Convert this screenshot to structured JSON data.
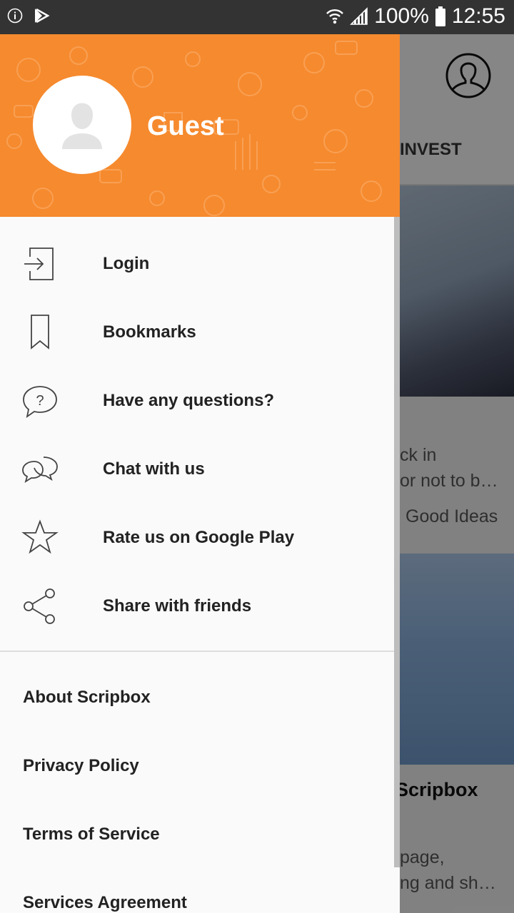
{
  "status_bar": {
    "battery": "100%",
    "time": "12:55",
    "icons": [
      "info-icon",
      "play-store-icon",
      "wifi-icon",
      "signal-icon",
      "battery-icon"
    ]
  },
  "drawer": {
    "username": "Guest",
    "menu": [
      {
        "label": "Login",
        "icon": "login-icon"
      },
      {
        "label": "Bookmarks",
        "icon": "bookmark-icon"
      },
      {
        "label": "Have any questions?",
        "icon": "question-icon"
      },
      {
        "label": "Chat with us",
        "icon": "chat-icon"
      },
      {
        "label": "Rate us on Google Play",
        "icon": "star-icon"
      },
      {
        "label": "Share with friends",
        "icon": "share-icon"
      }
    ],
    "links": [
      "About Scripbox",
      "Privacy Policy",
      "Terms of Service",
      "Services Agreement"
    ]
  },
  "background": {
    "tab": "INVEST",
    "card1_lines": [
      "ck in",
      "or not to b…"
    ],
    "card1_tag": "Good Ideas",
    "card2_title": "Scripbox",
    "card2_lines": [
      "page,",
      "ng and sh…"
    ]
  },
  "colors": {
    "accent": "#f68a2e",
    "status_bar": "#333333",
    "drawer_bg": "#fafafa",
    "text": "#222222"
  }
}
